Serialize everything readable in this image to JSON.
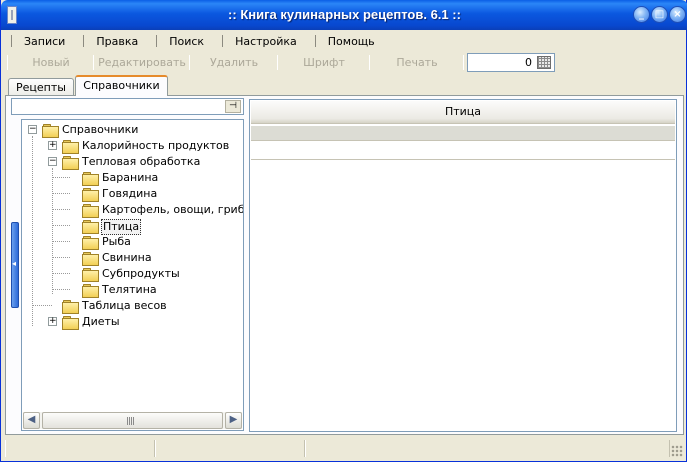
{
  "window": {
    "title": ":: Книга кулинарных рецептов. 6.1 ::"
  },
  "menu": [
    {
      "id": "records",
      "label": "Записи"
    },
    {
      "id": "edit",
      "label": "Правка"
    },
    {
      "id": "search",
      "label": "Поиск"
    },
    {
      "id": "settings",
      "label": "Настройка"
    },
    {
      "id": "help",
      "label": "Помощь"
    }
  ],
  "toolbar": {
    "new_label": "Новый",
    "edit_label": "Редактировать",
    "delete_label": "Удалить",
    "font_label": "Шрифт",
    "print_label": "Печать",
    "counter_value": "0"
  },
  "tabs": [
    {
      "label": "Рецепты",
      "active": false
    },
    {
      "label": "Справочники",
      "active": true
    }
  ],
  "tree": {
    "nodes": [
      {
        "label": "Справочники",
        "level": 0,
        "expander": "−",
        "selected": false
      },
      {
        "label": "Калорийность продуктов",
        "level": 1,
        "expander": "+",
        "selected": false
      },
      {
        "label": "Тепловая обработка",
        "level": 1,
        "expander": "−",
        "selected": false
      },
      {
        "label": "Баранина",
        "level": 2,
        "expander": "",
        "selected": false
      },
      {
        "label": "Говядина",
        "level": 2,
        "expander": "",
        "selected": false
      },
      {
        "label": "Картофель, овощи, грибы",
        "level": 2,
        "expander": "",
        "selected": false
      },
      {
        "label": "Птица",
        "level": 2,
        "expander": "",
        "selected": true
      },
      {
        "label": "Рыба",
        "level": 2,
        "expander": "",
        "selected": false
      },
      {
        "label": "Свинина",
        "level": 2,
        "expander": "",
        "selected": false
      },
      {
        "label": "Субпродукты",
        "level": 2,
        "expander": "",
        "selected": false
      },
      {
        "label": "Телятина",
        "level": 2,
        "expander": "",
        "selected": false
      },
      {
        "label": "Таблица весов",
        "level": 1,
        "expander": "",
        "selected": false
      },
      {
        "label": "Диеты",
        "level": 1,
        "expander": "+",
        "selected": false
      }
    ]
  },
  "grid": {
    "header": "Птица"
  },
  "icons": {
    "pin": "pin-icon",
    "folder": "folder-icon",
    "scroll_left": "arrow-left-icon",
    "scroll_right": "arrow-right-icon"
  },
  "colors": {
    "titlebar": "#0a5fe6",
    "active_tab_accent": "#e68b2c",
    "folder": "#f2cf55"
  }
}
